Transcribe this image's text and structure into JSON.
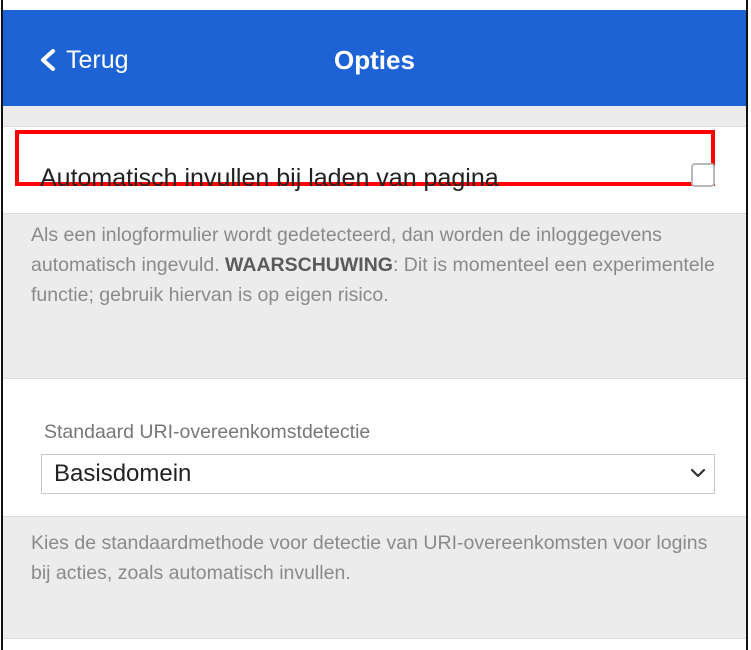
{
  "header": {
    "back_label": "Terug",
    "title": "Opties",
    "color": "#1e63d6"
  },
  "autofill": {
    "label": "Automatisch invullen bij laden van pagina",
    "checked": false,
    "help_text": "Als een inlogformulier wordt gedetecteerd, dan worden de inloggegevens automatisch ingevuld.",
    "warning_label": "WAARSCHUWING",
    "warning_text": ": Dit is momenteel een experimentele functie; gebruik hiervan is op eigen risico."
  },
  "uri_detection": {
    "label": "Standaard URI-overeenkomstdetectie",
    "selected": "Basisdomein",
    "help_text": "Kies de standaardmethode voor detectie van URI-overeenkomsten voor logins bij acties, zoals automatisch invullen."
  },
  "highlight_color": "#ff0000"
}
